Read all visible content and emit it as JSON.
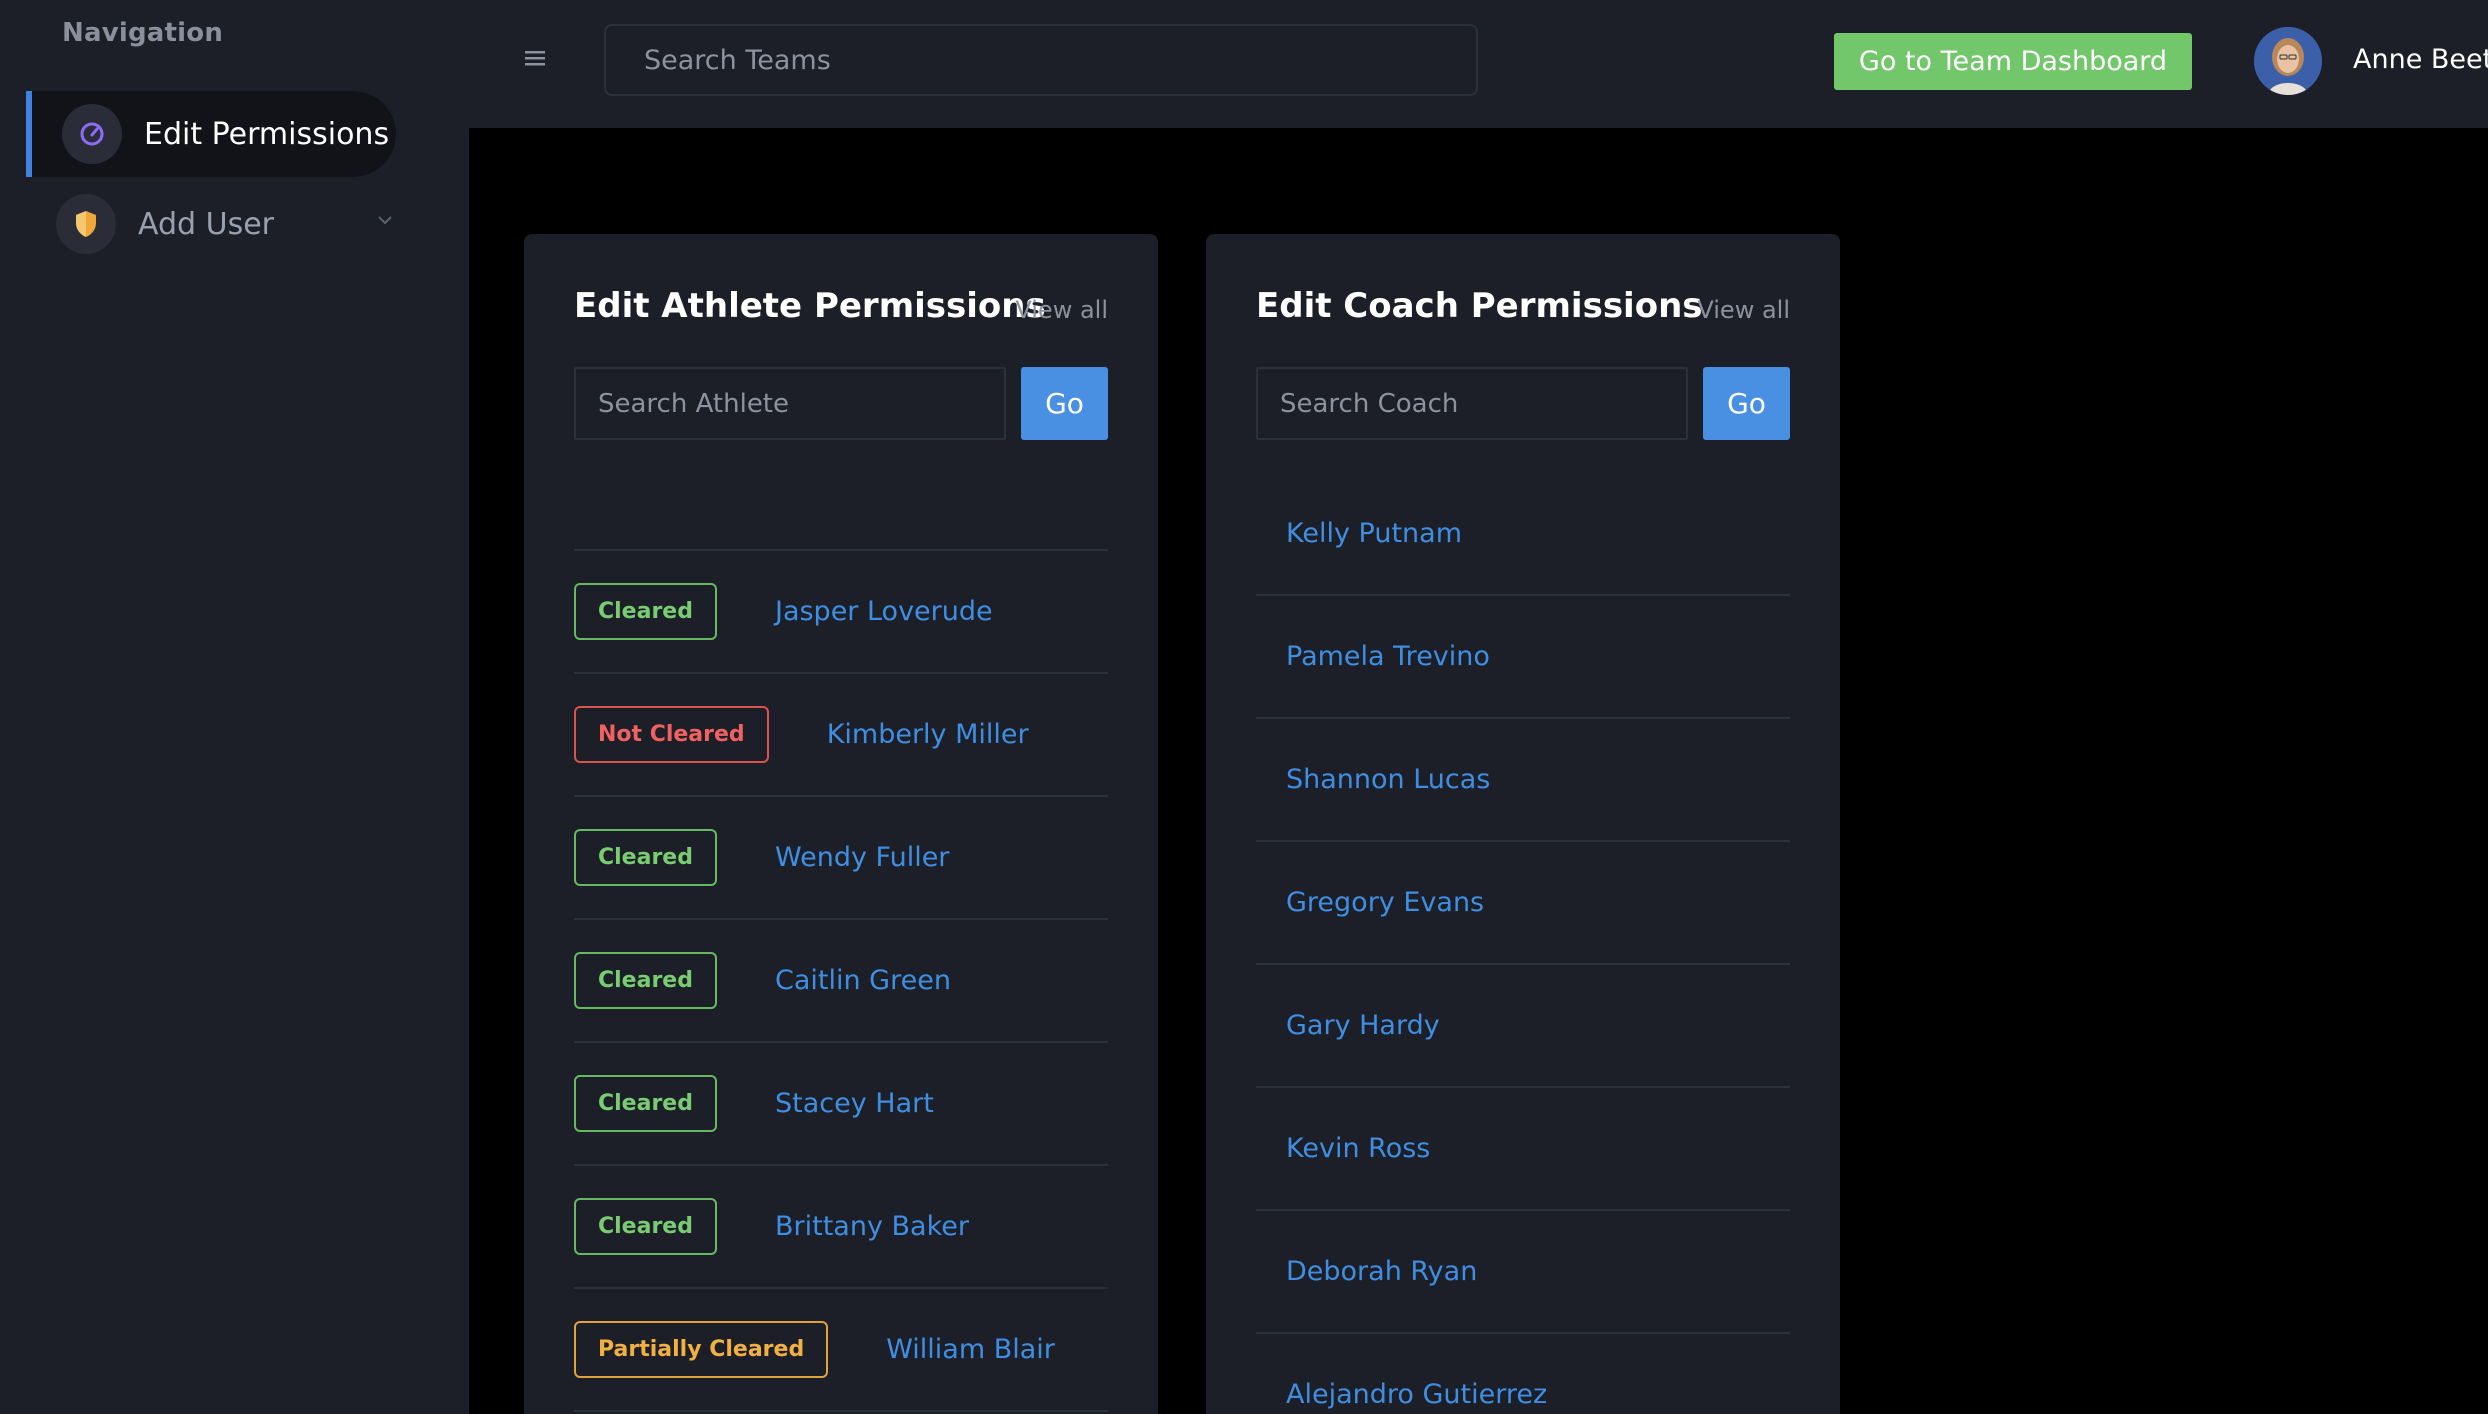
{
  "sidebar": {
    "heading": "Navigation",
    "items": [
      {
        "label": "Edit Permissions",
        "icon": "gauge-icon",
        "active": true
      },
      {
        "label": "Add User",
        "icon": "shield-icon",
        "active": false
      }
    ]
  },
  "header": {
    "search_placeholder": "Search Teams",
    "dashboard_button": "Go to Team Dashboard",
    "user_name": "Anne Beet"
  },
  "athlete_card": {
    "title": "Edit Athlete Permissions",
    "view_all": "View all",
    "search_placeholder": "Search Athlete",
    "go_label": "Go",
    "rows": [
      {
        "status": "Cleared",
        "status_type": "cleared",
        "name": "Jasper Loverude"
      },
      {
        "status": "Not Cleared",
        "status_type": "not-cleared",
        "name": "Kimberly Miller"
      },
      {
        "status": "Cleared",
        "status_type": "cleared",
        "name": "Wendy Fuller"
      },
      {
        "status": "Cleared",
        "status_type": "cleared",
        "name": "Caitlin Green"
      },
      {
        "status": "Cleared",
        "status_type": "cleared",
        "name": "Stacey Hart"
      },
      {
        "status": "Cleared",
        "status_type": "cleared",
        "name": "Brittany Baker"
      },
      {
        "status": "Partially Cleared",
        "status_type": "partial",
        "name": "William Blair"
      }
    ]
  },
  "coach_card": {
    "title": "Edit Coach Permissions",
    "view_all": "View all",
    "search_placeholder": "Search Coach",
    "go_label": "Go",
    "rows": [
      {
        "name": "Kelly Putnam"
      },
      {
        "name": "Pamela Trevino"
      },
      {
        "name": "Shannon Lucas"
      },
      {
        "name": "Gregory Evans"
      },
      {
        "name": "Gary Hardy"
      },
      {
        "name": "Kevin Ross"
      },
      {
        "name": "Deborah Ryan"
      },
      {
        "name": "Alejandro Gutierrez"
      }
    ]
  },
  "colors": {
    "accent_blue": "#4a90e2",
    "link_blue": "#3f8ee2",
    "dashboard_green": "#72c76a",
    "cleared_green": "#79cc72",
    "not_cleared_red": "#f06262",
    "partial_orange": "#f2b043"
  }
}
